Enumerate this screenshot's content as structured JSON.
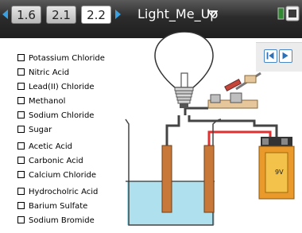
{
  "tabs": [
    "1.6",
    "2.1",
    "2.2"
  ],
  "active_tab": "2.2",
  "document_title": "Light_Me_Up",
  "chemicals": [
    "Potassium Chloride",
    "Nitric Acid",
    "Lead(II) Chloride",
    "Methanol",
    "Sodium Chloride",
    "Sugar",
    "Acetic Acid",
    "Carbonic Acid",
    "Calcium Chloride",
    "Hydrocholric Acid",
    "Barium Sulfate",
    "Sodium Bromide"
  ],
  "battery_label": "9V",
  "colors": {
    "accent_blue": "#3aa0e0",
    "solution": "#aee0ee",
    "electrode": "#c8793a",
    "wire_red": "#e03030",
    "battery_orange": "#e99a2a"
  }
}
